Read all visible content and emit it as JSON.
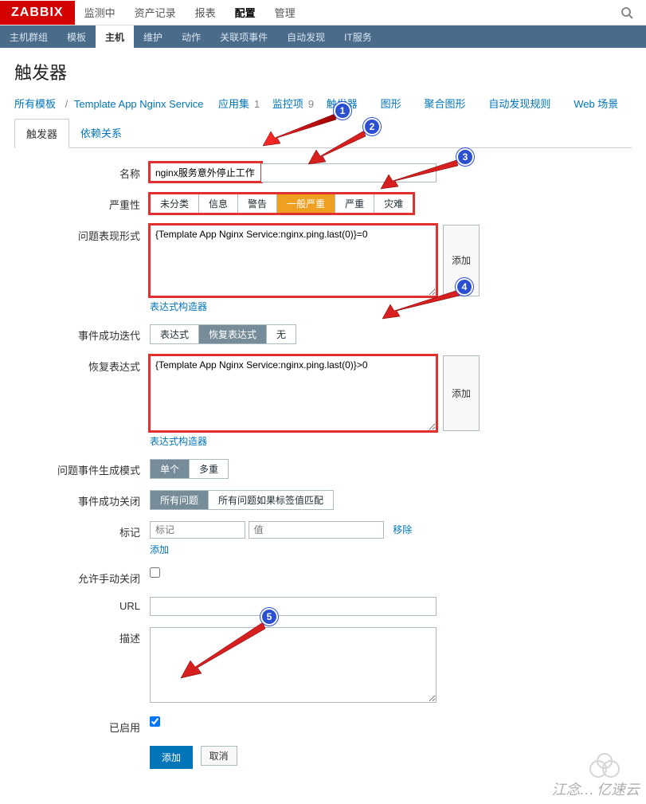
{
  "logo": "ZABBIX",
  "topnav": {
    "items": [
      "监测中",
      "资产记录",
      "报表",
      "配置",
      "管理"
    ],
    "active": 3
  },
  "subnav": {
    "items": [
      "主机群组",
      "模板",
      "主机",
      "维护",
      "动作",
      "关联项事件",
      "自动发现",
      "IT服务"
    ],
    "active": 2
  },
  "page_title": "触发器",
  "breadcrumb": {
    "all_templates": "所有模板",
    "template": "Template App Nginx Service",
    "items": [
      {
        "label": "应用集",
        "count": "1"
      },
      {
        "label": "监控项",
        "count": "9"
      },
      {
        "label": "触发器",
        "count": ""
      },
      {
        "label": "图形",
        "count": ""
      },
      {
        "label": "聚合图形",
        "count": ""
      },
      {
        "label": "自动发现规则",
        "count": ""
      },
      {
        "label": "Web 场景",
        "count": ""
      }
    ]
  },
  "tabs": {
    "items": [
      "触发器",
      "依赖关系"
    ],
    "active": 0
  },
  "form": {
    "name_label": "名称",
    "name_value": "nginx服务意外停止工作",
    "severity_label": "严重性",
    "severity_opts": [
      "未分类",
      "信息",
      "警告",
      "一般严重",
      "严重",
      "灾难"
    ],
    "severity_sel": 3,
    "expr_label": "问题表现形式",
    "expr_value": "{Template App Nginx Service:nginx.ping.last(0)}=0",
    "expr_add": "添加",
    "expr_builder": "表达式构造器",
    "event_gen_label": "事件成功迭代",
    "event_gen_opts": [
      "表达式",
      "恢复表达式",
      "无"
    ],
    "event_gen_sel": 1,
    "recov_label": "恢复表达式",
    "recov_value": "{Template App Nginx Service:nginx.ping.last(0)}>0",
    "recov_add": "添加",
    "recov_builder": "表达式构造器",
    "prob_mode_label": "问题事件生成模式",
    "prob_mode_opts": [
      "单个",
      "多重"
    ],
    "prob_mode_sel": 0,
    "ok_close_label": "事件成功关闭",
    "ok_close_opts": [
      "所有问题",
      "所有问题如果标签值匹配"
    ],
    "ok_close_sel": 0,
    "tags_label": "标记",
    "tag_name_ph": "标记",
    "tag_value_ph": "值",
    "tag_remove": "移除",
    "tag_add": "添加",
    "manual_close_label": "允许手动关闭",
    "url_label": "URL",
    "url_value": "",
    "desc_label": "描述",
    "desc_value": "",
    "enabled_label": "已启用",
    "submit": "添加",
    "cancel": "取消"
  },
  "watermark": "江念… 亿速云"
}
